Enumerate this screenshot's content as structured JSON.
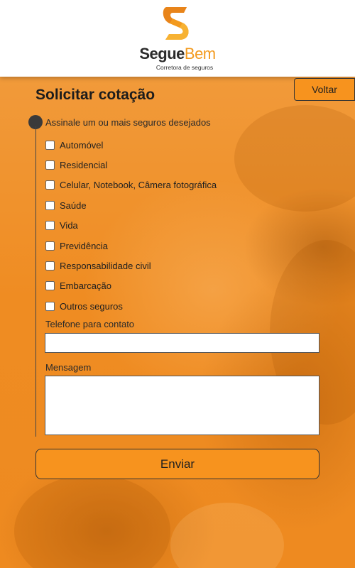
{
  "brand": {
    "name_bold": "Segue",
    "name_light": "Bem",
    "tagline": "Corretora de seguros",
    "accent": "#f39a1e",
    "dark": "#2b2b2b"
  },
  "nav": {
    "back_label": "Voltar"
  },
  "form": {
    "title": "Solicitar cotação",
    "insurance_prompt": "Assinale um ou mais seguros desejados",
    "options": [
      {
        "label": "Automóvel",
        "checked": false
      },
      {
        "label": "Residencial",
        "checked": false
      },
      {
        "label": "Celular, Notebook, Câmera fotográfica",
        "checked": false
      },
      {
        "label": "Saúde",
        "checked": false
      },
      {
        "label": "Vida",
        "checked": false
      },
      {
        "label": "Previdência",
        "checked": false
      },
      {
        "label": "Responsabilidade civil",
        "checked": false
      },
      {
        "label": "Embarcação",
        "checked": false
      },
      {
        "label": "Outros seguros",
        "checked": false
      }
    ],
    "phone_label": "Telefone para contato",
    "phone_value": "",
    "message_label": "Mensagem",
    "message_value": "",
    "submit_label": "Enviar"
  },
  "colors": {
    "background": "#f08a1c",
    "button": "#f7931e"
  }
}
